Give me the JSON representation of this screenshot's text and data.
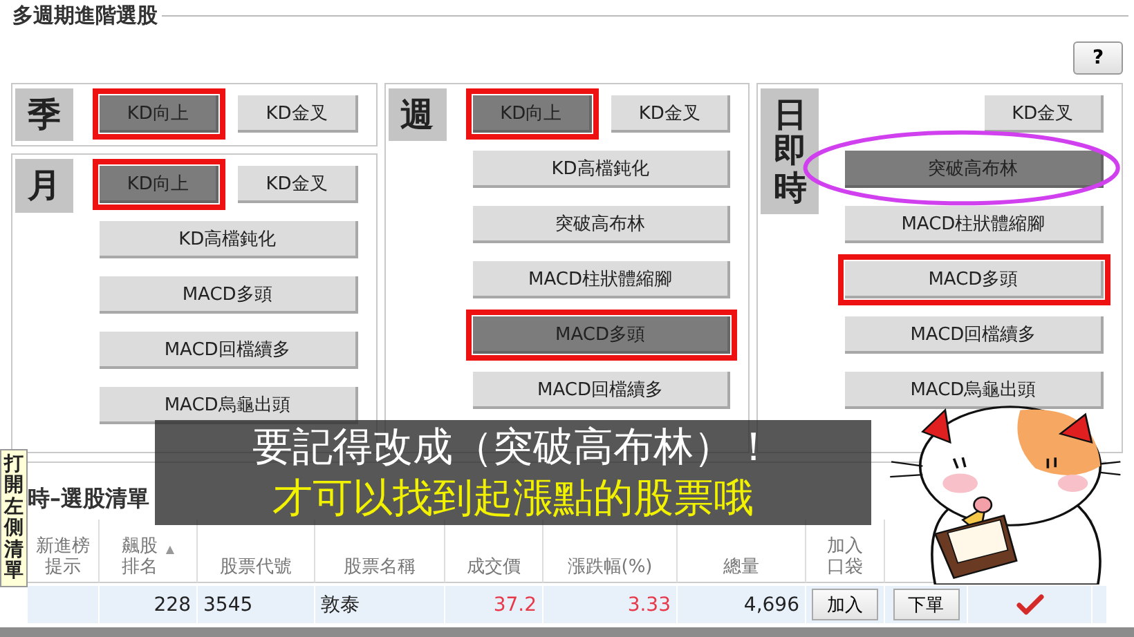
{
  "group_title": "多週期進階選股",
  "help_button": "?",
  "columns": [
    {
      "panels": [
        {
          "label": "季",
          "buttons": [
            {
              "label": "KD向上",
              "kind": "left",
              "selected": true,
              "marked": true,
              "circled": false
            },
            {
              "label": "KD金叉",
              "kind": "right",
              "selected": false,
              "marked": false,
              "circled": false
            }
          ]
        },
        {
          "label": "月",
          "buttons": [
            {
              "label": "KD向上",
              "kind": "left",
              "selected": true,
              "marked": true,
              "circled": false
            },
            {
              "label": "KD金叉",
              "kind": "right",
              "selected": false,
              "marked": false,
              "circled": false
            },
            {
              "label": "KD高檔鈍化",
              "kind": "wide",
              "selected": false,
              "marked": false,
              "circled": false
            },
            {
              "label": "MACD多頭",
              "kind": "wide",
              "selected": false,
              "marked": false,
              "circled": false
            },
            {
              "label": "MACD回檔續多",
              "kind": "wide",
              "selected": false,
              "marked": false,
              "circled": false
            },
            {
              "label": "MACD烏龜出頭",
              "kind": "wide",
              "selected": false,
              "marked": false,
              "circled": false
            }
          ]
        }
      ]
    },
    {
      "panels": [
        {
          "label": "週",
          "buttons": [
            {
              "label": "KD向上",
              "kind": "left",
              "selected": true,
              "marked": true,
              "circled": false
            },
            {
              "label": "KD金叉",
              "kind": "right",
              "selected": false,
              "marked": false,
              "circled": false
            },
            {
              "label": "KD高檔鈍化",
              "kind": "wide",
              "selected": false,
              "marked": false,
              "circled": false
            },
            {
              "label": "突破高布林",
              "kind": "wide",
              "selected": false,
              "marked": false,
              "circled": false
            },
            {
              "label": "MACD柱狀體縮腳",
              "kind": "wide",
              "selected": false,
              "marked": false,
              "circled": false
            },
            {
              "label": "MACD多頭",
              "kind": "wide",
              "selected": true,
              "marked": true,
              "circled": false
            },
            {
              "label": "MACD回檔續多",
              "kind": "wide",
              "selected": false,
              "marked": false,
              "circled": false
            }
          ]
        }
      ]
    },
    {
      "panels": [
        {
          "label": "日即時",
          "buttons": [
            {
              "label": "KD金叉",
              "kind": "right",
              "selected": false,
              "marked": false,
              "circled": false
            },
            {
              "label": "突破高布林",
              "kind": "wide",
              "selected": true,
              "marked": false,
              "circled": true
            },
            {
              "label": "MACD柱狀體縮腳",
              "kind": "wide",
              "selected": false,
              "marked": false,
              "circled": false
            },
            {
              "label": "MACD多頭",
              "kind": "wide",
              "selected": false,
              "marked": true,
              "circled": false
            },
            {
              "label": "MACD回檔續多",
              "kind": "wide",
              "selected": false,
              "marked": false,
              "circled": false
            },
            {
              "label": "MACD烏龜出頭",
              "kind": "wide",
              "selected": false,
              "marked": false,
              "circled": false
            }
          ]
        }
      ]
    }
  ],
  "list": {
    "title": "時–選股清單",
    "tooltip": "打開左側清單",
    "columns": [
      {
        "label": "新進榜提示"
      },
      {
        "label": "飆股排名",
        "sort_mark": "▲"
      },
      {
        "label": "股票代號"
      },
      {
        "label": "股票名稱"
      },
      {
        "label": "成交價"
      },
      {
        "label": "漲跌幅(%)"
      },
      {
        "label": "總量"
      },
      {
        "label": "加入口袋"
      }
    ],
    "rows": [
      {
        "rank": "228",
        "code": "3545",
        "name": "敦泰",
        "price": "37.2",
        "change": "3.33",
        "volume": "4,696",
        "add_button": "加入",
        "order_button": "下單",
        "checked": true
      }
    ]
  },
  "caption": {
    "line_1": "要記得改成（突破高布林）！",
    "line_2": "才可以找到起漲點的股票哦"
  }
}
